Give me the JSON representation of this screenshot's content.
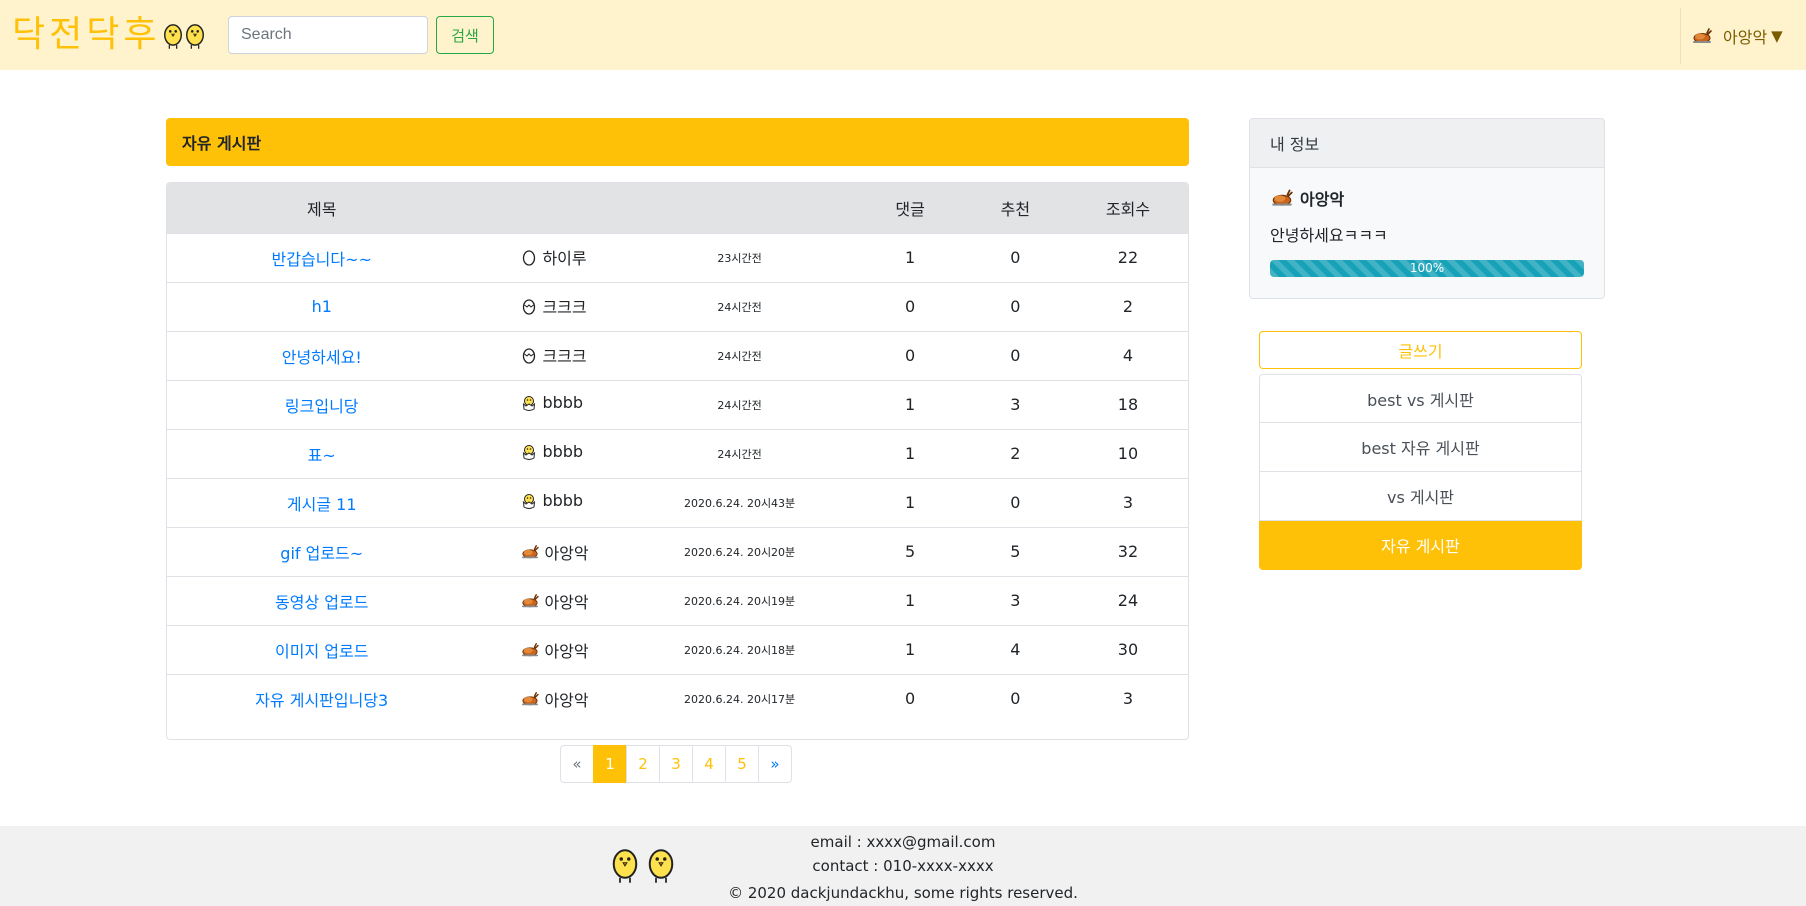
{
  "header": {
    "brand": "닥전닥후",
    "search_placeholder": "Search",
    "search_button": "검색",
    "user_name": "아앙악",
    "caret": "▼"
  },
  "board": {
    "title": "자유 게시판",
    "columns": {
      "title": "제목",
      "comments": "댓글",
      "recommend": "추천",
      "views": "조회수"
    },
    "rows": [
      {
        "title": "반갑습니다~~",
        "author": "하이루",
        "icon": "egg-icon",
        "time": "23시간전",
        "comments": "1",
        "recommend": "0",
        "views": "22"
      },
      {
        "title": "h1",
        "author": "크크크",
        "icon": "cracked-egg-icon",
        "time": "24시간전",
        "comments": "0",
        "recommend": "0",
        "views": "2"
      },
      {
        "title": "안녕하세요!",
        "author": "크크크",
        "icon": "cracked-egg-icon",
        "time": "24시간전",
        "comments": "0",
        "recommend": "0",
        "views": "4"
      },
      {
        "title": "링크입니당",
        "author": "bbbb",
        "icon": "hatching-chick-icon",
        "time": "24시간전",
        "comments": "1",
        "recommend": "3",
        "views": "18"
      },
      {
        "title": "표~",
        "author": "bbbb",
        "icon": "hatching-chick-icon",
        "time": "24시간전",
        "comments": "1",
        "recommend": "2",
        "views": "10"
      },
      {
        "title": "게시글 11",
        "author": "bbbb",
        "icon": "hatching-chick-icon",
        "time": "2020.6.24. 20시43분",
        "comments": "1",
        "recommend": "0",
        "views": "3"
      },
      {
        "title": "gif 업로드~",
        "author": "아앙악",
        "icon": "roast-chicken-icon",
        "time": "2020.6.24. 20시20분",
        "comments": "5",
        "recommend": "5",
        "views": "32"
      },
      {
        "title": "동영상 업로드",
        "author": "아앙악",
        "icon": "roast-chicken-icon",
        "time": "2020.6.24. 20시19분",
        "comments": "1",
        "recommend": "3",
        "views": "24"
      },
      {
        "title": "이미지 업로드",
        "author": "아앙악",
        "icon": "roast-chicken-icon",
        "time": "2020.6.24. 20시18분",
        "comments": "1",
        "recommend": "4",
        "views": "30"
      },
      {
        "title": "자유 게시판입니당3",
        "author": "아앙악",
        "icon": "roast-chicken-icon",
        "time": "2020.6.24. 20시17분",
        "comments": "0",
        "recommend": "0",
        "views": "3"
      }
    ]
  },
  "pagination": {
    "prev": "«",
    "pages": [
      "1",
      "2",
      "3",
      "4",
      "5"
    ],
    "active": "1",
    "next": "»"
  },
  "sidebar": {
    "info_title": "내 정보",
    "user_name": "아앙악",
    "message": "안녕하세요ㅋㅋㅋ",
    "progress_label": "100%",
    "progress_value": 100,
    "write_button": "글쓰기",
    "boards": [
      "best vs 게시판",
      "best 자유 게시판",
      "vs 게시판",
      "자유 게시판"
    ],
    "active_board": "자유 게시판"
  },
  "footer": {
    "email": "email : xxxx@gmail.com",
    "contact": "contact : 010-xxxx-xxxx",
    "copyright": "© 2020 dackjundackhu, some rights reserved."
  },
  "colors": {
    "accent": "#ffc107",
    "header_bg": "#fff3cd",
    "link": "#007bff",
    "success": "#28a745",
    "progress": "#17a2b8"
  }
}
